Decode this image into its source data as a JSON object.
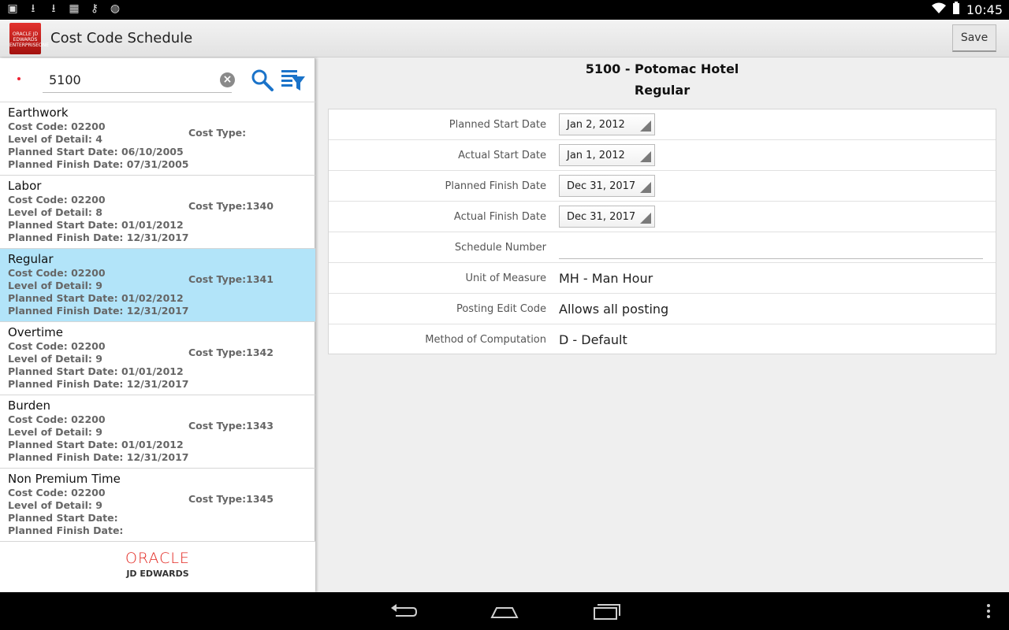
{
  "status": {
    "time": "10:45"
  },
  "app": {
    "title": "Cost Code Schedule",
    "save_label": "Save",
    "logo_text": "ORACLE JD EDWARDS ENTERPRISEONE"
  },
  "search": {
    "value": "5100"
  },
  "list": [
    {
      "title": "Earthwork",
      "cost_code": "Cost Code: 02200",
      "cost_type": "Cost Type:",
      "level": "Level of Detail: 4",
      "start": "Planned Start Date: 06/10/2005",
      "finish": "Planned Finish Date: 07/31/2005"
    },
    {
      "title": "Labor",
      "cost_code": "Cost Code: 02200",
      "cost_type": "Cost Type:1340",
      "level": "Level of Detail: 8",
      "start": "Planned Start Date: 01/01/2012",
      "finish": "Planned Finish Date: 12/31/2017"
    },
    {
      "title": "Regular",
      "cost_code": "Cost Code: 02200",
      "cost_type": "Cost Type:1341",
      "level": "Level of Detail: 9",
      "start": "Planned Start Date: 01/02/2012",
      "finish": "Planned Finish Date: 12/31/2017"
    },
    {
      "title": "Overtime",
      "cost_code": "Cost Code: 02200",
      "cost_type": "Cost Type:1342",
      "level": "Level of Detail: 9",
      "start": "Planned Start Date: 01/01/2012",
      "finish": "Planned Finish Date: 12/31/2017"
    },
    {
      "title": "Burden",
      "cost_code": "Cost Code: 02200",
      "cost_type": "Cost Type:1343",
      "level": "Level of Detail: 9",
      "start": "Planned Start Date: 01/01/2012",
      "finish": "Planned Finish Date: 12/31/2017"
    },
    {
      "title": "Non Premium Time",
      "cost_code": "Cost Code: 02200",
      "cost_type": "Cost Type:1345",
      "level": "Level of Detail: 9",
      "start": "Planned Start Date:",
      "finish": "Planned Finish Date:"
    }
  ],
  "footer": {
    "oracle": "ORACLE",
    "jde": "JD EDWARDS"
  },
  "detail": {
    "heading": "5100 - Potomac Hotel",
    "subheading": "Regular",
    "planned_start_label": "Planned Start Date",
    "planned_start_value": "Jan 2, 2012",
    "actual_start_label": "Actual Start Date",
    "actual_start_value": "Jan 1, 2012",
    "planned_finish_label": "Planned Finish Date",
    "planned_finish_value": "Dec 31, 2017",
    "actual_finish_label": "Actual Finish Date",
    "actual_finish_value": "Dec 31, 2017",
    "schedule_number_label": "Schedule Number",
    "schedule_number_value": "",
    "uom_label": "Unit of Measure",
    "uom_value": "MH - Man Hour",
    "posting_label": "Posting Edit Code",
    "posting_value": "Allows all posting",
    "method_label": "Method of Computation",
    "method_value": "D - Default"
  },
  "colors": {
    "selected_row": "#b2e4f9",
    "accent_blue": "#1a73c9",
    "oracle_red": "#e2261f"
  }
}
